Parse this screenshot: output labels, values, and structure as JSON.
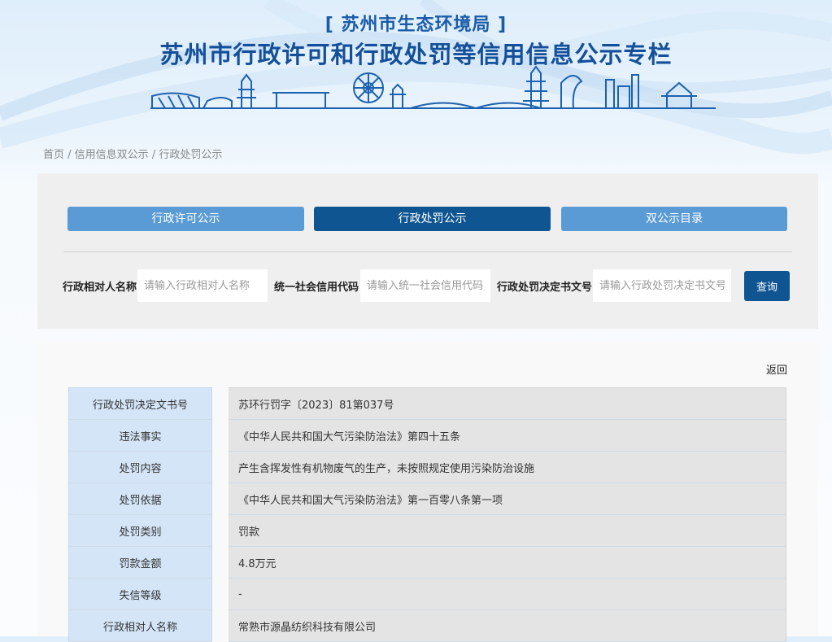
{
  "header": {
    "bureau": "[ 苏州市生态环境局 ]",
    "title": "苏州市行政许可和行政处罚等信用信息公示专栏"
  },
  "breadcrumb": {
    "items": [
      "首页",
      "信用信息双公示",
      "行政处罚公示"
    ],
    "sep": " / "
  },
  "tabs": [
    {
      "label": "行政许可公示",
      "active": false
    },
    {
      "label": "行政处罚公示",
      "active": true
    },
    {
      "label": "双公示目录",
      "active": false
    }
  ],
  "search": {
    "name_label": "行政相对人名称",
    "name_placeholder": "请输入行政相对人名称",
    "code_label": "统一社会信用代码",
    "code_placeholder": "请输入统一社会信用代码",
    "doc_label": "行政处罚决定书文号",
    "doc_placeholder": "请输入行政处罚决定书文号",
    "button": "查询"
  },
  "detail": {
    "back": "返回",
    "rows": [
      {
        "label": "行政处罚决定文书号",
        "value": "苏环行罚字〔2023〕81第037号"
      },
      {
        "label": "违法事实",
        "value": "《中华人民共和国大气污染防治法》第四十五条"
      },
      {
        "label": "处罚内容",
        "value": "产生含挥发性有机物废气的生产，未按照规定使用污染防治设施"
      },
      {
        "label": "处罚依据",
        "value": "《中华人民共和国大气污染防治法》第一百零八条第一项"
      },
      {
        "label": "处罚类别",
        "value": "罚款"
      },
      {
        "label": "罚款金额",
        "value": "4.8万元"
      },
      {
        "label": "失信等级",
        "value": "-"
      },
      {
        "label": "行政相对人名称",
        "value": "常熟市源晶纺织科技有限公司"
      }
    ]
  },
  "colors": {
    "brand": "#14509a",
    "tab_active": "#0e5592",
    "tab_light": "#5b9bd5",
    "label_bg": "#d4e5f7",
    "value_bg": "#e4e4e4"
  }
}
